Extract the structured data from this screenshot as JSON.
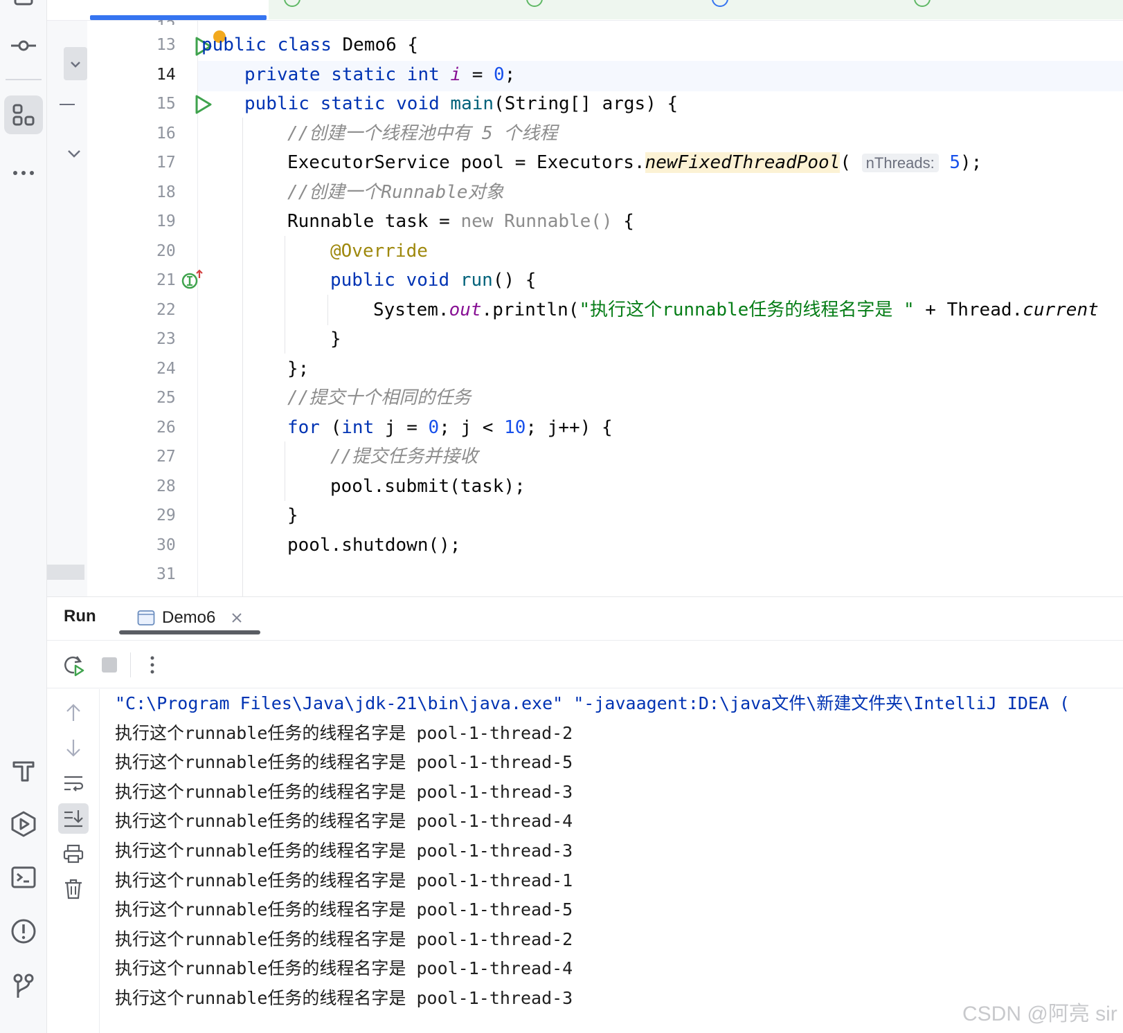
{
  "run_panel": {
    "title": "Run",
    "tab_label": "Demo6",
    "console_lines": [
      "\"C:\\Program Files\\Java\\jdk-21\\bin\\java.exe\" \"-javaagent:D:\\java文件\\新建文件夹\\IntelliJ IDEA (",
      "执行这个runnable任务的线程名字是 pool-1-thread-2",
      "执行这个runnable任务的线程名字是 pool-1-thread-5",
      "执行这个runnable任务的线程名字是 pool-1-thread-3",
      "执行这个runnable任务的线程名字是 pool-1-thread-4",
      "执行这个runnable任务的线程名字是 pool-1-thread-3",
      "执行这个runnable任务的线程名字是 pool-1-thread-1",
      "执行这个runnable任务的线程名字是 pool-1-thread-5",
      "执行这个runnable任务的线程名字是 pool-1-thread-2",
      "执行这个runnable任务的线程名字是 pool-1-thread-4",
      "执行这个runnable任务的线程名字是 pool-1-thread-3"
    ]
  },
  "editor": {
    "line_numbers": [
      "13",
      "14",
      "15",
      "16",
      "17",
      "18",
      "19",
      "20",
      "21",
      "22",
      "23",
      "24",
      "25",
      "26",
      "27",
      "28",
      "29",
      "30",
      "31"
    ],
    "tokens": {
      "l13_kw1": "public",
      "l13_kw2": "class",
      "l13_name": "Demo6 {",
      "l14_kw": "private static int",
      "l14_field": "i",
      "l14_eq": "=",
      "l14_num": "0",
      "l14_end": ";",
      "l15_kw": "public static void",
      "l15_method": "main",
      "l15_rest": "(String[] args) {",
      "l16_comment": "//创建一个线程池中有 5 个线程",
      "l17_pre": "ExecutorService pool = Executors.",
      "l17_call": "newFixedThreadPool",
      "l17_paren": "(",
      "l17_hint": "nThreads:",
      "l17_num": "5",
      "l17_end": ");",
      "l18_comment": "//创建一个Runnable对象",
      "l19_pre": "Runnable task =",
      "l19_gray": "new Runnable()",
      "l19_brace": "{",
      "l20_ann": "@Override",
      "l21_kw": "public void",
      "l21_method": "run",
      "l21_rest": "() {",
      "l22_pre": "System.",
      "l22_out": "out",
      "l22_call": ".println(",
      "l22_str": "\"执行这个runnable任务的线程名字是 \"",
      "l22_rest": " + Thread.",
      "l22_tail": "current",
      "l23": "}",
      "l24": "};",
      "l25_comment": "//提交十个相同的任务",
      "l26_kw": "for",
      "l26_a": " (",
      "l26_int": "int",
      "l26_b": " j = ",
      "l26_zero": "0",
      "l26_c": "; j < ",
      "l26_ten": "10",
      "l26_d": "; j++) {",
      "l27_comment": "//提交任务并接收",
      "l28": "pool.submit(task);",
      "l29": "}",
      "l30": "pool.shutdown();"
    }
  },
  "watermark": "CSDN @阿亮 sir",
  "colors": {
    "keyword": "#0033b3",
    "field": "#871094",
    "number": "#1750eb",
    "comment": "#8c8c8c",
    "string": "#067d17",
    "annotation": "#9e880d",
    "run_gutter": "#3fa34d",
    "accent": "#3574f0"
  },
  "icons": {
    "left_strip": [
      "commit-icon",
      "structure-icon",
      "more-icon",
      "build-icon",
      "services-icon",
      "terminal-icon",
      "problems-icon",
      "git-icon"
    ],
    "toolbar": [
      "rerun-icon",
      "stop-icon",
      "more-vertical-icon"
    ],
    "console_side": [
      "scroll-up-icon",
      "scroll-down-icon",
      "soft-wrap-icon",
      "scroll-to-end-icon",
      "print-icon",
      "clear-icon"
    ]
  }
}
